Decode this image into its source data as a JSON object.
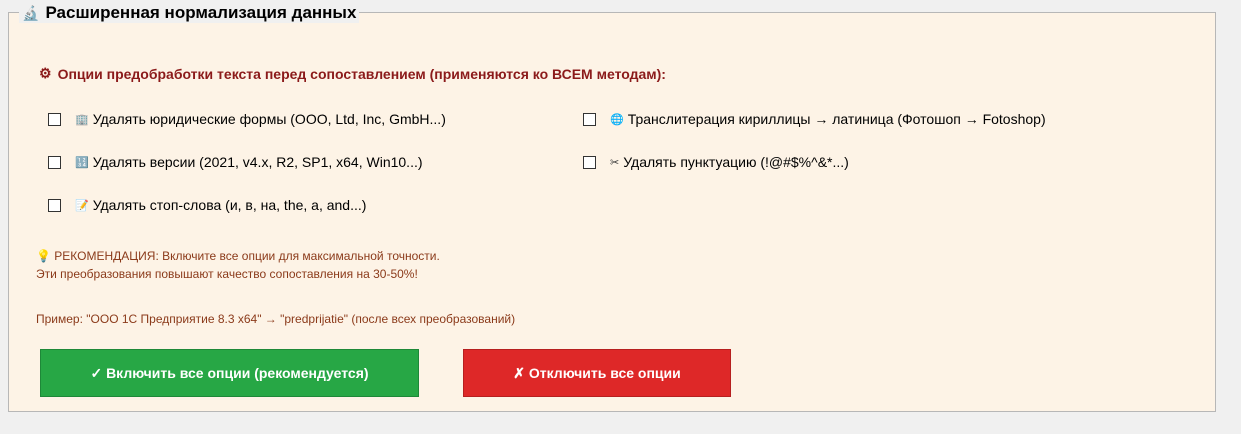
{
  "legend": {
    "icon": "🔬",
    "title": "Расширенная нормализация данных"
  },
  "header": {
    "icon": "⚙",
    "text": "Опции предобработки текста перед сопоставлением (применяются ко ВСЕМ методам):"
  },
  "options": [
    {
      "icon": "🏢",
      "label": "Удалять юридические формы (ООО, Ltd, Inc, GmbH...)"
    },
    {
      "icon": "🌐",
      "label": "Транслитерация кириллицы → латиница (Фотошоп → Fotoshop)"
    },
    {
      "icon": "🔢",
      "label": "Удалять версии (2021, v4.x, R2, SP1, x64, Win10...)"
    },
    {
      "icon": "✂",
      "label": "Удалять пунктуацию (!@#$%^&*...)"
    },
    {
      "icon": "📝",
      "label": "Удалять стоп-слова (и, в, на, the, a, and...)"
    }
  ],
  "recommendation": {
    "line1": "💡 РЕКОМЕНДАЦИЯ: Включите все опции для максимальной точности.",
    "line2": "Эти преобразования повышают качество сопоставления на 30-50%!"
  },
  "example": "Пример: \"ООО 1С Предприятие 8.3 x64\" → \"predprijatie\" (после всех преобразований)",
  "buttons": {
    "enable_all": "✓ Включить все опции (рекомендуется)",
    "disable_all": "✗ Отключить все опции"
  },
  "colors": {
    "accent_text": "#8b1a1a",
    "green": "#27a745",
    "red": "#de2828",
    "panel_bg": "#fdf3e6"
  }
}
